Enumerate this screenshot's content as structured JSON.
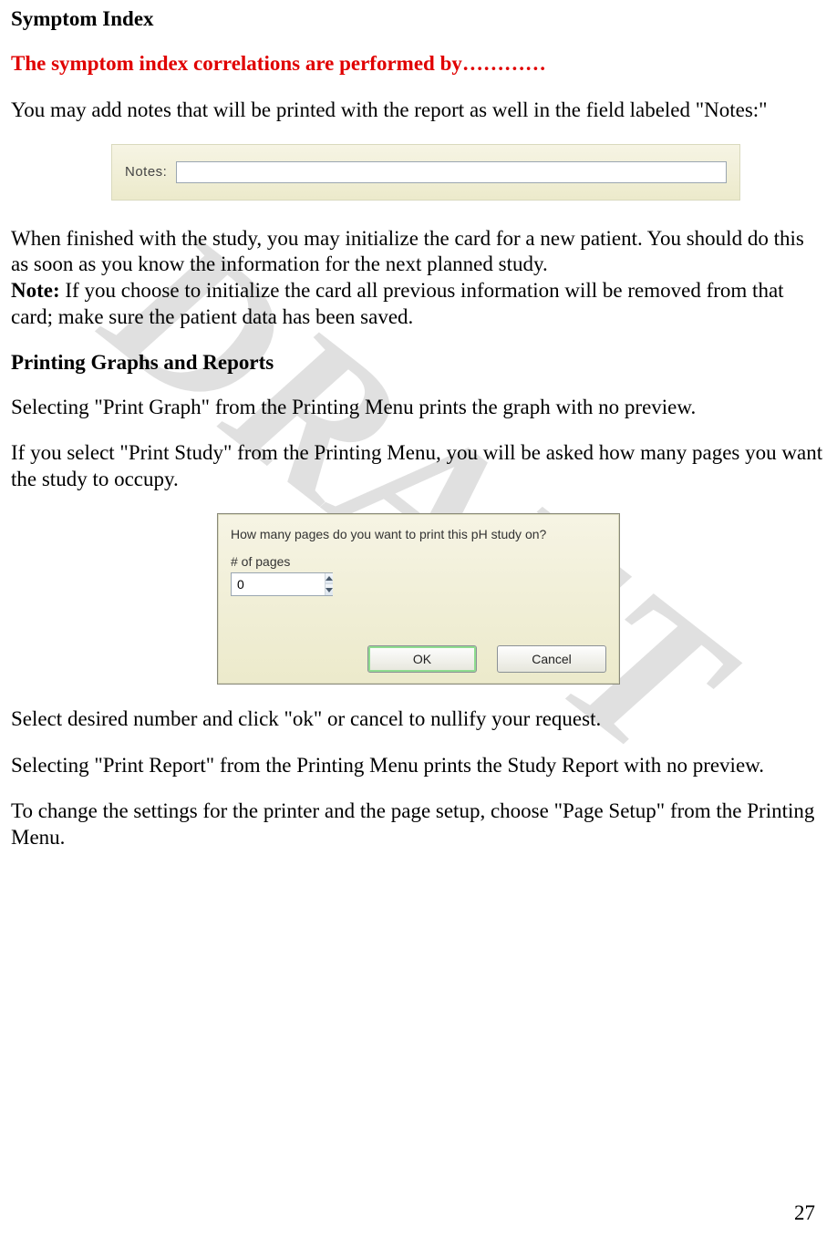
{
  "watermark": "DRAFT",
  "section1": {
    "title": "Symptom Index",
    "red_line": "The symptom index correlations are performed by…………",
    "p1": "You may add notes that will be printed with the report as well in the field labeled \"Notes:\""
  },
  "notes_field": {
    "label": "Notes:",
    "value": ""
  },
  "section1b": {
    "p2": "When finished with the study, you may initialize the card for a new patient. You should do this as soon as you know the information for the next planned study.",
    "note_label": "Note:",
    "note_text": " If you choose to initialize the card all previous information will be removed from that card; make sure the patient data has been saved."
  },
  "section2": {
    "title": "Printing Graphs and Reports",
    "p1": "Selecting \"Print Graph\" from the Printing Menu prints the graph with no preview.",
    "p2": "If you select \"Print Study\" from the Printing Menu, you will be asked how many pages you want the study to occupy."
  },
  "dialog": {
    "prompt": "How many pages do you want to print this pH study on?",
    "field_label": "# of pages",
    "value": "0",
    "ok_label": "OK",
    "cancel_label": "Cancel"
  },
  "section3": {
    "p1": "Select desired number and click \"ok\" or cancel to nullify your request.",
    "p2": "Selecting \"Print Report\" from the Printing Menu prints the Study Report with no preview.",
    "p3": "To change the settings for the printer and the page setup, choose \"Page Setup\" from the Printing Menu."
  },
  "page_number": "27"
}
